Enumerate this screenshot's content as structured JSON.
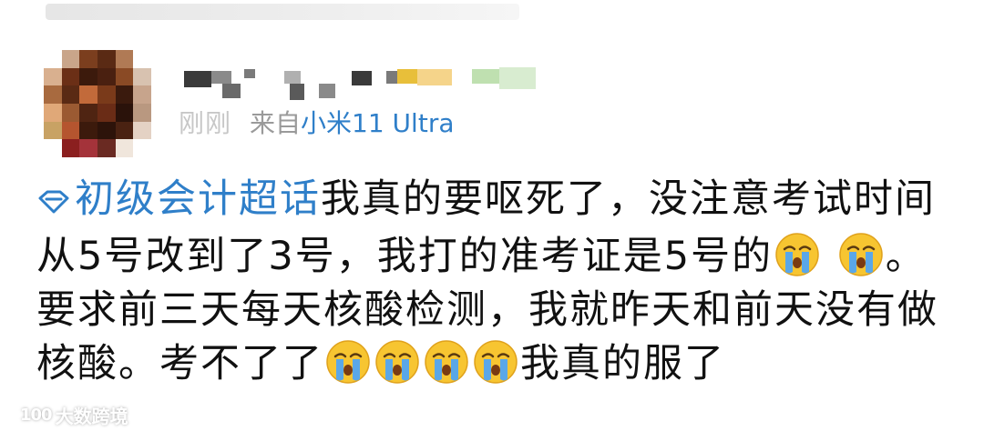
{
  "post": {
    "timestamp": "刚刚",
    "source_prefix": "来自",
    "device": "小米11 Ultra",
    "topic": "初级会计超话",
    "body_parts": [
      "我真的要呕死了，没注意考试时间从5号改到了3号，我打的准考证是5号的",
      "。要求前三天每天核酸检测，我就昨天和前天没有做核酸。考不了了",
      "我真的服了"
    ]
  },
  "watermark": {
    "logo": "100",
    "text": "大数跨境"
  },
  "icons": {
    "topic": "diamond-topic-icon",
    "emoji": "crying-emoji-icon"
  },
  "colors": {
    "link_blue": "#2f7fc9",
    "text": "#111111",
    "meta_gray": "#9a9a9a"
  }
}
